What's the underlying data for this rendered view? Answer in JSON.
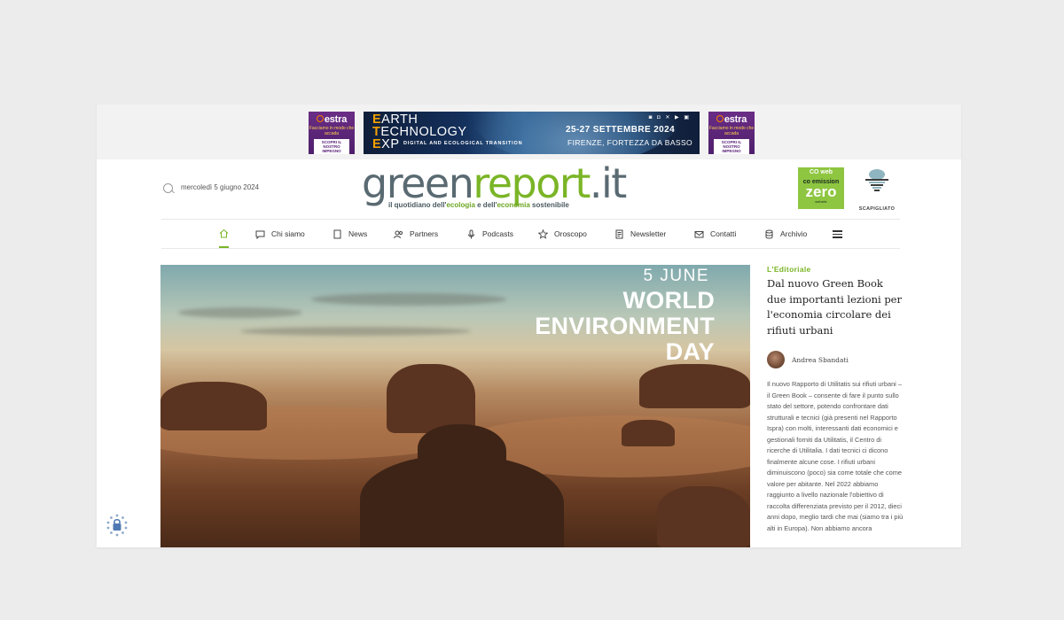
{
  "ads": {
    "left": {
      "brand": "estra",
      "tagline": "Facciamo in modo che accada",
      "cta": "SCOPRI IL NOSTRO IMPEGNO"
    },
    "right": {
      "brand": "estra",
      "tagline": "Facciamo in modo che accada",
      "cta": "SCOPRI IL NOSTRO IMPEGNO"
    },
    "banner": {
      "line1": "ARTH",
      "line2": "ECHNOLOGY",
      "line3": "XP",
      "l1": "E",
      "l2": "T",
      "l3": "E",
      "subtitle": "DIGITAL AND ECOLOGICAL TRANSITION",
      "date": "25-27  SETTEMBRE  2024",
      "place": "FIRENZE, FORTEZZA DA BASSO"
    }
  },
  "header": {
    "date": "mercoledì 5 giugno 2024",
    "logo": {
      "part1": "green",
      "part2": "report",
      "part3": ".it"
    },
    "tagline_pre": "il quotidiano dell'",
    "tagline_eco": "ecologia",
    "tagline_mid": " e dell'",
    "tagline_econ": "economia",
    "tagline_post": " sostenibile",
    "co2": {
      "a": "CO web",
      "b": "co emission",
      "c": "zero",
      "d": "website"
    },
    "scapigliato": {
      "name": "SCAPIGLIATO"
    }
  },
  "nav": {
    "items": [
      {
        "label": "Chi siamo",
        "icon": "chat-icon"
      },
      {
        "label": "News",
        "icon": "document-icon"
      },
      {
        "label": "Partners",
        "icon": "users-icon"
      },
      {
        "label": "Podcasts",
        "icon": "microphone-icon"
      },
      {
        "label": "Oroscopo",
        "icon": "star-icon"
      },
      {
        "label": "Newsletter",
        "icon": "newsletter-icon"
      },
      {
        "label": "Contatti",
        "icon": "mail-icon"
      },
      {
        "label": "Archivio",
        "icon": "database-icon"
      }
    ]
  },
  "hero": {
    "date": "5 JUNE",
    "title_line1": "WORLD",
    "title_line2": "ENVIRONMENT",
    "title_line3": "DAY"
  },
  "editorial": {
    "category": "L'Editoriale",
    "title": "Dal nuovo Green Book due importanti lezioni per l'economia circolare dei rifiuti urbani",
    "author": "Andrea Sbandati",
    "excerpt": "Il nuovo Rapporto di Utilitatis sui rifiuti urbani – il Green Book – consente di fare il punto sullo stato del settore, potendo confrontare dati strutturali e tecnici (già presenti nel Rapporto Ispra) con molti, interessanti dati economici e gestionali forniti da Utilitatis, il Centro di ricerche di Utilitalia. I dati tecnici ci dicono finalmente alcune cose. I rifiuti urbani diminuiscono (poco) sia come totale che come valore per abitante. Nel 2022 abbiamo raggiunto a livello nazionale l'obiettivo di raccolta differenziata previsto per il 2012, dieci anni dopo, meglio tardi che mai (siamo tra i più alti in Europa). Non abbiamo ancora"
  },
  "colors": {
    "accent": "#7ab526",
    "logo_gray": "#5a6a72",
    "ad_purple": "#5a2279"
  }
}
